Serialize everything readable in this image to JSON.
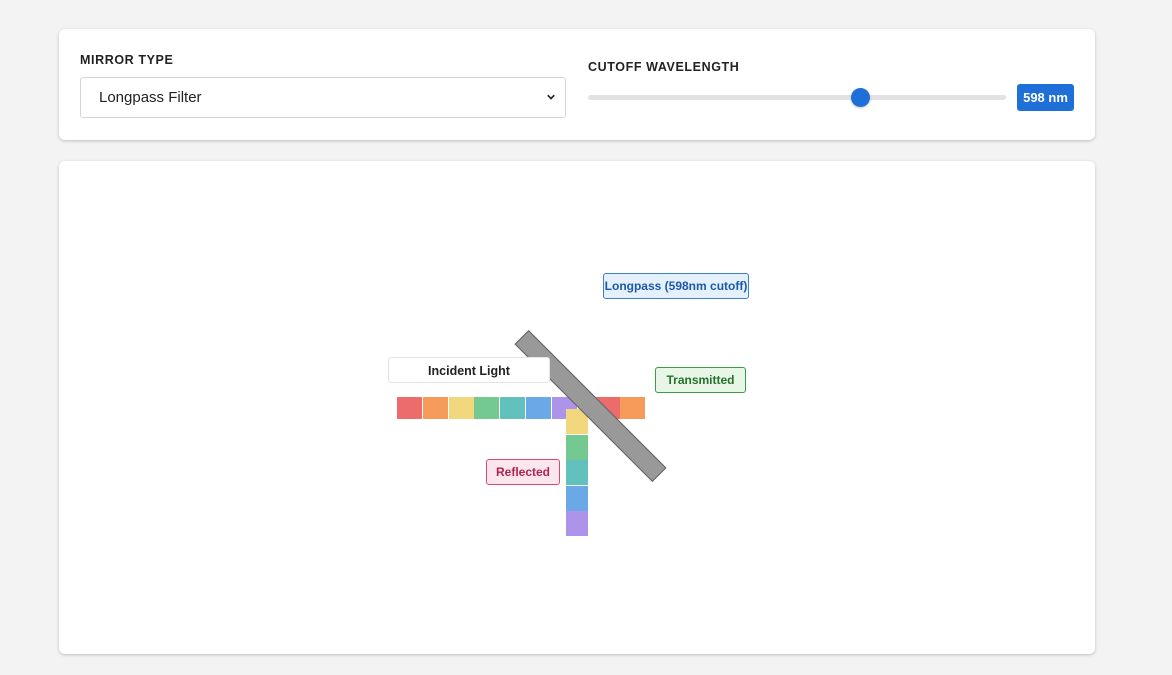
{
  "controls": {
    "mirror_type_label": "MIRROR TYPE",
    "mirror_type_value": "Longpass Filter",
    "cutoff_label": "CUTOFF WAVELENGTH",
    "cutoff_value_text": "598 nm",
    "cutoff_nm": 598,
    "slider_fraction": 0.653,
    "accent_color": "#1e6fd8"
  },
  "diagram": {
    "mirror_tag": "Longpass (598nm cutoff)",
    "incident_tag": "Incident Light",
    "transmitted_tag": "Transmitted",
    "reflected_tag": "Reflected",
    "incident_colors": [
      "#ec6b6b",
      "#f59c5a",
      "#f2d77e",
      "#73c98f",
      "#62c1bd",
      "#6aa9e6",
      "#ad94ea"
    ],
    "transmitted_colors": [
      "#ec6b6b",
      "#f59c5a"
    ],
    "reflected_colors": [
      "#f2d77e",
      "#73c98f",
      "#62c1bd",
      "#6aa9e6",
      "#ad94ea"
    ],
    "mirror_color": "#999999"
  }
}
